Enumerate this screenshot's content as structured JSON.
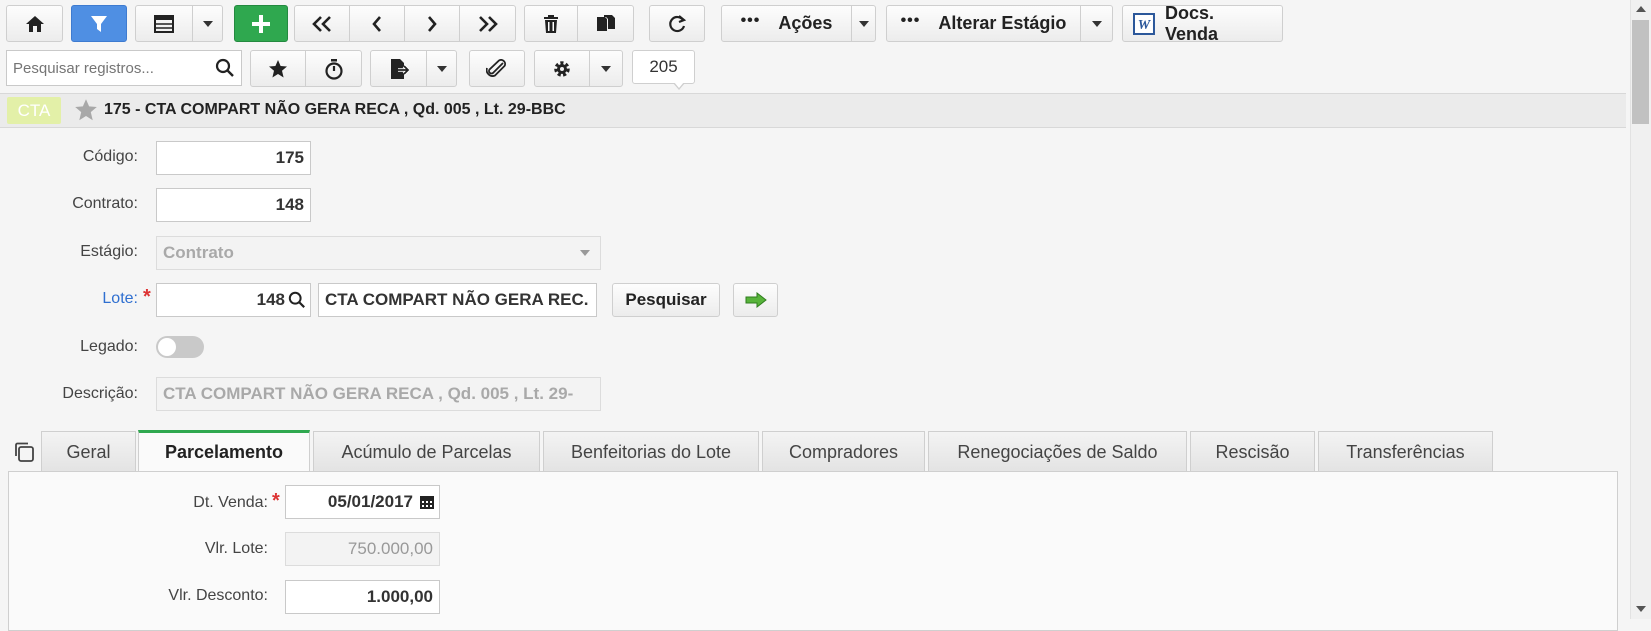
{
  "toolbar": {
    "acoes_label": "Ações",
    "alterar_estagio_label": "Alterar Estágio",
    "docs_venda_label": "Docs. Venda",
    "search_placeholder": "Pesquisar registros...",
    "record_count": "205"
  },
  "record": {
    "badge": "CTA",
    "title": "175 - CTA COMPART NÃO GERA RECA , Qd. 005 , Lt. 29-BBC"
  },
  "form": {
    "codigo_label": "Código:",
    "codigo_value": "175",
    "contrato_label": "Contrato:",
    "contrato_value": "148",
    "estagio_label": "Estágio:",
    "estagio_value": "Contrato",
    "lote_label": "Lote:",
    "lote_value": "148",
    "lote_desc": "CTA COMPART NÃO GERA REC.",
    "pesquisar_label": "Pesquisar",
    "legado_label": "Legado:",
    "descricao_label": "Descrição:",
    "descricao_value": "CTA COMPART NÃO GERA RECA ,  Qd. 005 ,  Lt. 29-"
  },
  "tabs": [
    {
      "label": "Geral"
    },
    {
      "label": "Parcelamento"
    },
    {
      "label": "Acúmulo de Parcelas"
    },
    {
      "label": "Benfeitorias do Lote"
    },
    {
      "label": "Compradores"
    },
    {
      "label": "Renegociações de Saldo"
    },
    {
      "label": "Rescisão"
    },
    {
      "label": "Transferências"
    }
  ],
  "parcelamento": {
    "dt_venda_label": "Dt. Venda:",
    "dt_venda_value": "05/01/2017",
    "vlr_lote_label": "Vlr. Lote:",
    "vlr_lote_value": "750.000,00",
    "vlr_desconto_label": "Vlr. Desconto:",
    "vlr_desconto_value": "1.000,00"
  }
}
